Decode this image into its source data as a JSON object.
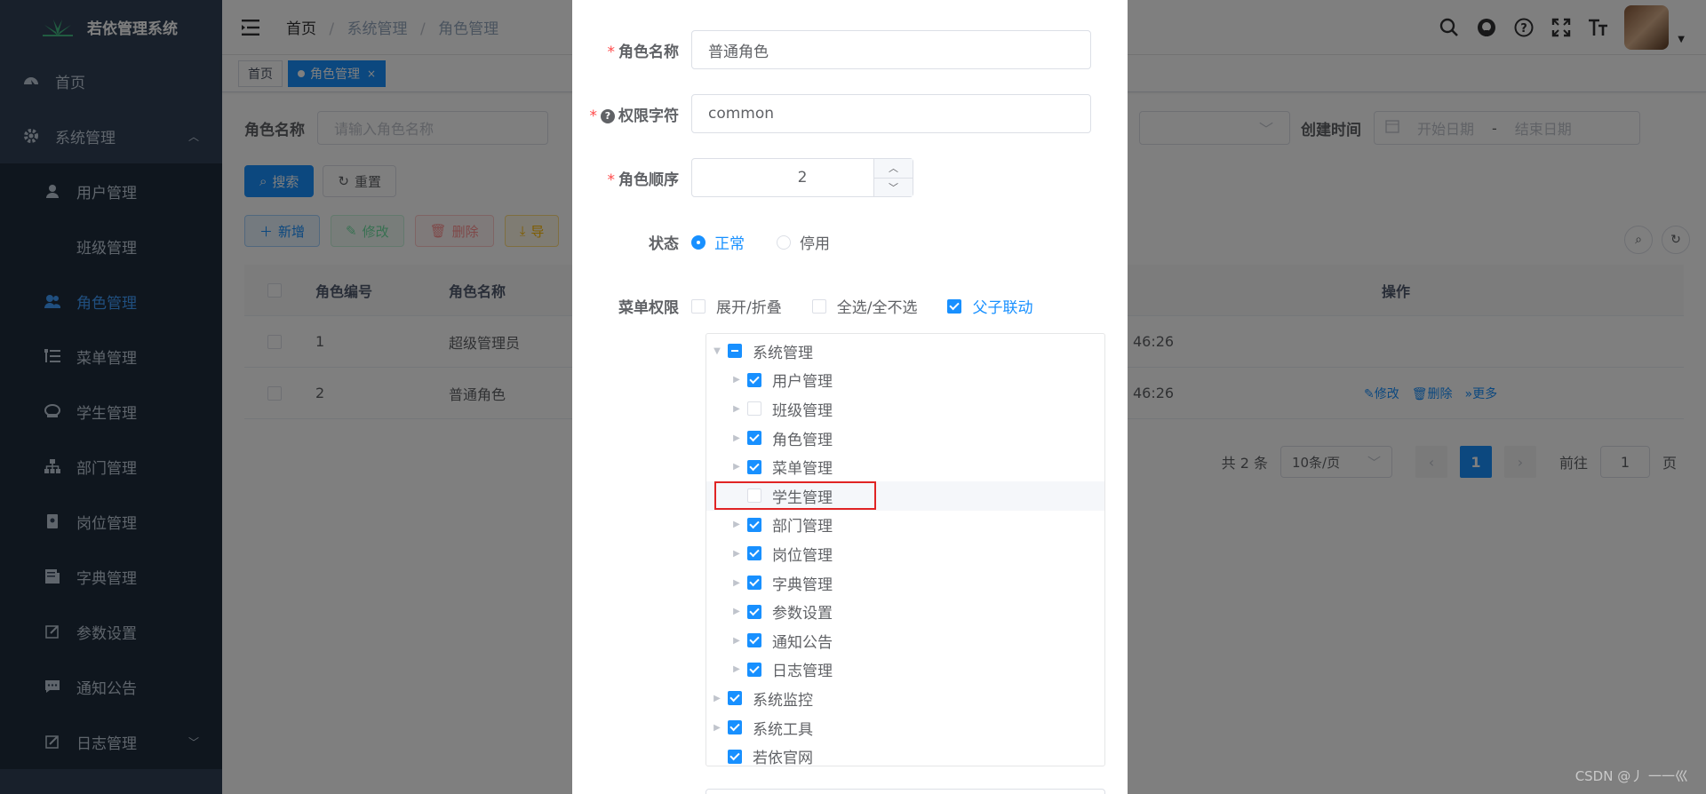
{
  "app": {
    "title": "若依管理系统"
  },
  "sidebar": {
    "items": [
      {
        "label": "首页",
        "icon": "dashboard-icon"
      },
      {
        "label": "系统管理",
        "icon": "gear-icon"
      }
    ],
    "sub_items": [
      {
        "label": "用户管理",
        "icon": "user-icon"
      },
      {
        "label": "班级管理",
        "icon": ""
      },
      {
        "label": "角色管理",
        "icon": "peoples-icon",
        "active": true
      },
      {
        "label": "菜单管理",
        "icon": "tree-table-icon"
      },
      {
        "label": "学生管理",
        "icon": "education-icon"
      },
      {
        "label": "部门管理",
        "icon": "tree-icon"
      },
      {
        "label": "岗位管理",
        "icon": "post-icon"
      },
      {
        "label": "字典管理",
        "icon": "dict-icon"
      },
      {
        "label": "参数设置",
        "icon": "edit-icon"
      },
      {
        "label": "通知公告",
        "icon": "message-icon"
      },
      {
        "label": "日志管理",
        "icon": "log-icon"
      }
    ]
  },
  "breadcrumb": {
    "home": "首页",
    "section": "系统管理",
    "current": "角色管理",
    "sep": "/"
  },
  "tags": {
    "home": "首页",
    "active": "角色管理",
    "close": "×"
  },
  "search": {
    "role_name_label": "角色名称",
    "role_name_placeholder": "请输入角色名称",
    "created_label": "创建时间",
    "start_placeholder": "开始日期",
    "range_sep": "-",
    "end_placeholder": "结束日期",
    "search_btn": "搜索",
    "reset_btn": "重置"
  },
  "toolbar": {
    "add": "新增",
    "edit": "修改",
    "delete": "删除",
    "export": "导"
  },
  "table": {
    "headers": {
      "id": "角色编号",
      "name": "角色名称",
      "ops": "操作"
    },
    "rows": [
      {
        "id": "1",
        "name": "超级管理员",
        "time": "46:26"
      },
      {
        "id": "2",
        "name": "普通角色",
        "time": "46:26",
        "edit": "修改",
        "delete": "删除",
        "more": "更多"
      }
    ]
  },
  "pagination": {
    "total": "共 2 条",
    "size": "10条/页",
    "page": "1",
    "goto": "前往",
    "goto_val": "1",
    "unit": "页"
  },
  "dialog": {
    "role_name_label": "角色名称",
    "role_name_value": "普通角色",
    "perm_label": "权限字符",
    "perm_value": "common",
    "order_label": "角色顺序",
    "order_value": "2",
    "status_label": "状态",
    "status_normal": "正常",
    "status_disabled": "停用",
    "menu_label": "菜单权限",
    "expand": "展开/折叠",
    "select_all": "全选/全不选",
    "linkage": "父子联动",
    "tree": [
      {
        "label": "系统管理",
        "level": 1,
        "state": "indeterminate",
        "caret": "down"
      },
      {
        "label": "用户管理",
        "level": 2,
        "state": "checked",
        "caret": "right"
      },
      {
        "label": "班级管理",
        "level": 2,
        "state": "unchecked",
        "caret": "right"
      },
      {
        "label": "角色管理",
        "level": 2,
        "state": "checked",
        "caret": "right"
      },
      {
        "label": "菜单管理",
        "level": 2,
        "state": "checked",
        "caret": "right"
      },
      {
        "label": "学生管理",
        "level": 2,
        "state": "unchecked",
        "caret": "none",
        "highlighted": true
      },
      {
        "label": "部门管理",
        "level": 2,
        "state": "checked",
        "caret": "right"
      },
      {
        "label": "岗位管理",
        "level": 2,
        "state": "checked",
        "caret": "right"
      },
      {
        "label": "字典管理",
        "level": 2,
        "state": "checked",
        "caret": "right"
      },
      {
        "label": "参数设置",
        "level": 2,
        "state": "checked",
        "caret": "right"
      },
      {
        "label": "通知公告",
        "level": 2,
        "state": "checked",
        "caret": "right"
      },
      {
        "label": "日志管理",
        "level": 2,
        "state": "checked",
        "caret": "right"
      },
      {
        "label": "系统监控",
        "level": 1,
        "state": "checked",
        "caret": "right"
      },
      {
        "label": "系统工具",
        "level": 1,
        "state": "checked",
        "caret": "right"
      },
      {
        "label": "若依官网",
        "level": 1,
        "state": "checked",
        "caret": "none"
      }
    ]
  },
  "watermark": "CSDN @丿 一一巛",
  "colors": {
    "sidebar_bg": "#304156",
    "primary": "#1890ff",
    "highlight_border": "#e02424"
  }
}
